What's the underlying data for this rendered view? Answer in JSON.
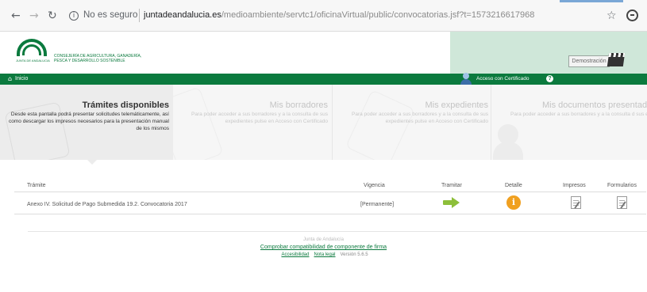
{
  "browser": {
    "back_icon": "arrow-left-icon",
    "forward_icon": "arrow-right-icon",
    "reload_icon": "reload-icon",
    "security_label": "No es seguro",
    "url_domain": "juntadeandalucia.es",
    "url_path": "/medioambiente/servtc1/oficinaVirtual/public/convocatorias.jsf?t=1573216617968"
  },
  "header": {
    "logo_caption": "JUNTA DE ANDALUCIA",
    "consejeria_line1": "CONSEJERÍA DE AGRICULTURA, GANADERÍA,",
    "consejeria_line2": "PESCA Y DESARROLLO SOSTENIBLE",
    "demo_label": "Demostración"
  },
  "nav": {
    "home_label": "Inicio",
    "certificate_label": "Acceso con Certificado"
  },
  "panels": [
    {
      "title": "Trámites disponibles",
      "desc": "Desde esta pantalla podrá presentar solicitudes telemáticamente, así como descargar los impresos necesarios para la presentación manual de los mismos"
    },
    {
      "title": "Mis borradores",
      "desc": "Para poder acceder a sus borradores y a la consulta de sus expedientes pulse en Acceso con Certificado"
    },
    {
      "title": "Mis expedientes",
      "desc": "Para poder acceder a sus borradores y a la consulta de sus expedientes pulse en Acceso con Certificado"
    },
    {
      "title": "Mis documentos presentado",
      "desc": "Para poder acceder a sus borradores y a la consulta d sus expedientes pulse en Acceso con Certificad"
    }
  ],
  "table": {
    "headers": [
      "Trámite",
      "Vigencia",
      "Tramitar",
      "Detalle",
      "Impresos",
      "Formularios"
    ],
    "rows": [
      {
        "tramite": "Anexo IV. Solicitud de Pago Submedida 19.2. Convocatoria 2017",
        "vigencia": "[Permanente]"
      }
    ]
  },
  "footer": {
    "org": "Junta de Andalucía",
    "compat_link": "Comprobar compatibilidad de componente de firma",
    "accesibilidad": "Accesibilidad",
    "nota_legal": "Nota legal",
    "version": "Versión 5.6.5"
  },
  "colors": {
    "green": "#0b7a3e",
    "light_green": "#cfe7d9",
    "orange": "#f0a020",
    "arrow_green": "#8dbf3a"
  }
}
